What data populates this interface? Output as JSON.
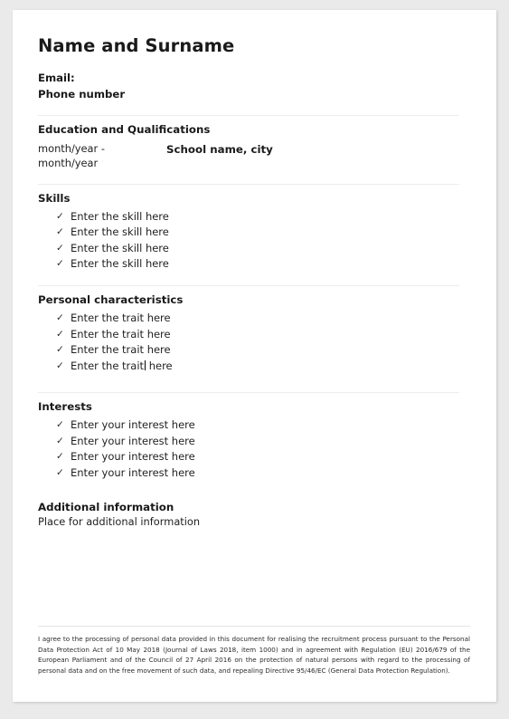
{
  "document": {
    "title": "Name and Surname",
    "contact": {
      "email_label": "Email:",
      "phone_label": "Phone number"
    },
    "education": {
      "heading": "Education and Qualifications",
      "entries": [
        {
          "dates": "month/year - month/year",
          "school": "School name, city"
        }
      ]
    },
    "skills": {
      "heading": "Skills",
      "items": [
        "Enter the skill here",
        "Enter the skill here",
        "Enter the skill here",
        "Enter the skill here"
      ]
    },
    "personal_characteristics": {
      "heading": "Personal characteristics",
      "items": [
        "Enter the trait here",
        "Enter the trait here",
        "Enter the trait here"
      ],
      "caret_item": {
        "before_caret": "Enter the trait",
        "after_caret": " here"
      }
    },
    "interests": {
      "heading": "Interests",
      "items": [
        "Enter your interest here",
        "Enter your interest here",
        "Enter your interest here",
        "Enter your interest here"
      ]
    },
    "additional_information": {
      "heading": "Additional information",
      "body": "Place for additional information"
    },
    "footer": {
      "consent_text": "I agree to the processing of personal data provided in this document for realising the recruitment process pursuant to the Personal Data Protection Act of 10 May 2018 (Journal of Laws 2018, item 1000) and in agreement with Regulation (EU) 2016/679 of the European Parliament and of the Council of 27 April 2016 on the protection of natural persons with regard to the processing of personal data and on the free movement of such data, and repealing Directive 95/46/EC (General Data Protection Regulation)."
    },
    "icons": {
      "bullet_check": "✓"
    }
  }
}
